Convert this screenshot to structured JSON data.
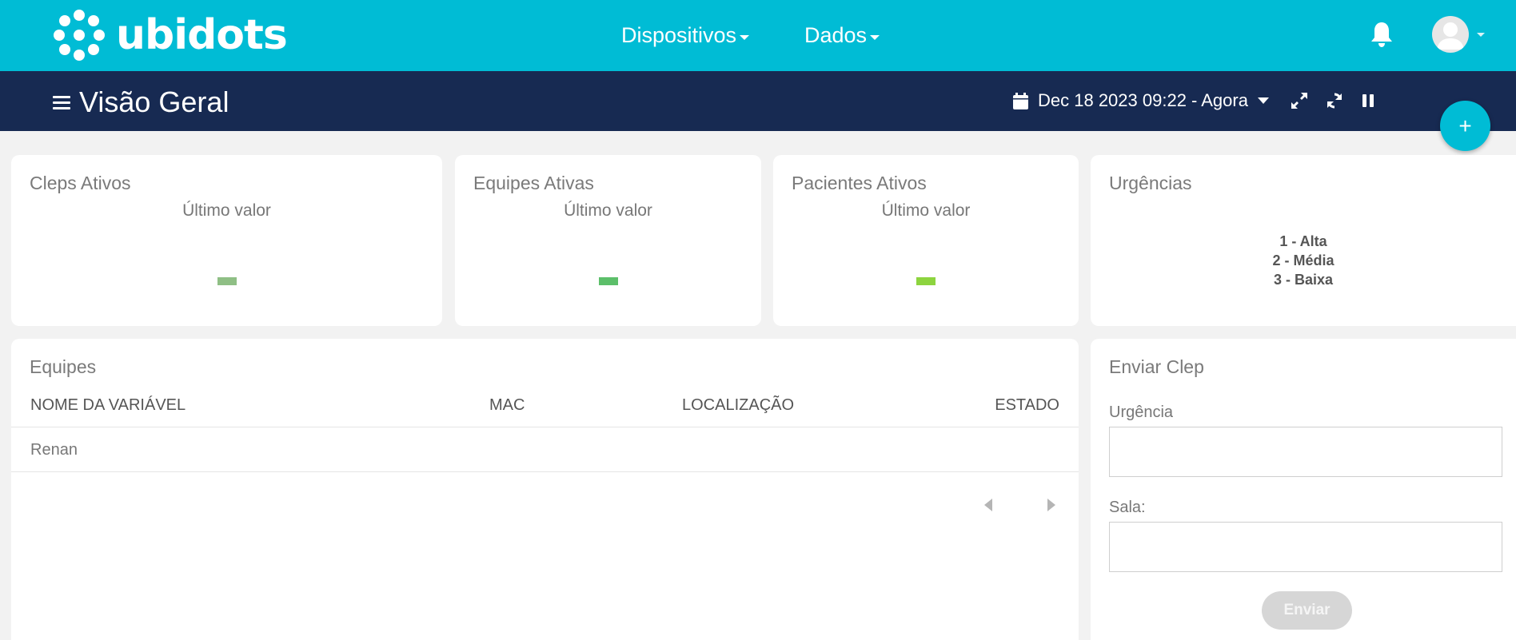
{
  "header": {
    "logo_text": "ubidots",
    "nav": [
      {
        "label": "Dispositivos"
      },
      {
        "label": "Dados"
      }
    ]
  },
  "subheader": {
    "title": "Visão Geral",
    "date_range": "Dec 18 2023 09:22 - Agora"
  },
  "widgets": {
    "cleps": {
      "title": "Cleps Ativos",
      "label": "Último valor",
      "value": "-",
      "color": "#8fbf85"
    },
    "equipes": {
      "title": "Equipes Ativas",
      "label": "Último valor",
      "value": "-",
      "color": "#5cbf6a"
    },
    "pacientes": {
      "title": "Pacientes Ativos",
      "label": "Último valor",
      "value": "-",
      "color": "#8dd43f"
    },
    "urgencias": {
      "title": "Urgências",
      "items": [
        "1 - Alta",
        "2 - Média",
        "3 - Baixa"
      ]
    }
  },
  "table": {
    "title": "Equipes",
    "columns": [
      "NOME DA VARIÁVEL",
      "MAC",
      "LOCALIZAÇÃO",
      "ESTADO"
    ],
    "rows": [
      {
        "nome": "Renan",
        "mac": "",
        "localizacao": "",
        "estado": ""
      }
    ]
  },
  "form": {
    "title": "Enviar Clep",
    "fields": [
      {
        "label": "Urgência",
        "value": ""
      },
      {
        "label": "Sala:",
        "value": ""
      }
    ],
    "submit_label": "Enviar"
  },
  "colors": {
    "topbar": "#00bcd5",
    "subbar": "#172a52",
    "background": "#f2f2f2"
  }
}
